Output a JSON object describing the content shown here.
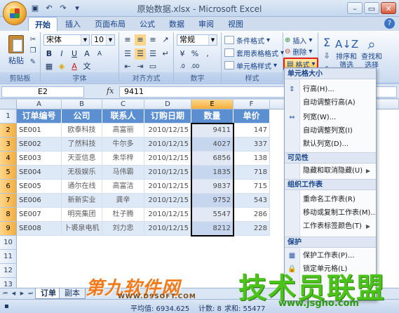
{
  "window": {
    "title": "原始数据.xlsx - Microsoft Excel"
  },
  "tabs": [
    "开始",
    "插入",
    "页面布局",
    "公式",
    "数据",
    "审阅",
    "视图"
  ],
  "ribbon": {
    "clipboard": {
      "label": "剪贴板",
      "paste": "粘贴"
    },
    "font": {
      "label": "字体",
      "name": "宋体",
      "size": "10"
    },
    "alignment": {
      "label": "对齐方式"
    },
    "number": {
      "label": "数字",
      "format": "常规"
    },
    "styles": {
      "label": "样式",
      "conditional": "条件格式",
      "table": "套用表格格式",
      "cell": "单元格样式"
    },
    "cells": {
      "insert": "插入",
      "delete": "删除",
      "format": "格式"
    },
    "editing": {
      "sigma": "Σ",
      "sort": "排序和",
      "filter": "筛选",
      "find": "查找和",
      "select": "选择"
    }
  },
  "formula_bar": {
    "name_box": "E2",
    "fx": "fx",
    "content": "9411"
  },
  "grid": {
    "columns": [
      "A",
      "B",
      "C",
      "D",
      "E",
      "F"
    ],
    "rows": [
      "1",
      "2",
      "3",
      "4",
      "5",
      "6",
      "7",
      "8",
      "9",
      "10",
      "11",
      "12",
      "13"
    ],
    "header": [
      "订单编号",
      "公司",
      "联系人",
      "订购日期",
      "数量",
      "单价"
    ],
    "data": [
      [
        "SE001",
        "欧泰科技",
        "高富丽",
        "2010/12/15",
        "9411",
        "147"
      ],
      [
        "SE002",
        "了然科技",
        "牛尔多",
        "2010/12/15",
        "4027",
        "337"
      ],
      [
        "SE003",
        "天亚信息",
        "朱华梓",
        "2010/12/15",
        "6856",
        "138"
      ],
      [
        "SE004",
        "无极娱乐",
        "马伟霸",
        "2010/12/15",
        "1835",
        "718"
      ],
      [
        "SE005",
        "通尔在线",
        "高富洁",
        "2010/12/15",
        "9837",
        "715"
      ],
      [
        "SE006",
        "新新实业",
        "龚辛",
        "2010/12/15",
        "9752",
        "543"
      ],
      [
        "SE007",
        "明亮集团",
        "杜子腾",
        "2010/12/15",
        "5547",
        "286"
      ],
      [
        "SE008",
        "卜裘泉电机",
        "刘力忠",
        "2010/12/15",
        "8212",
        "228"
      ]
    ]
  },
  "sheets": [
    "订单",
    "副本"
  ],
  "status": {
    "average": "平均值: 6934.625",
    "count": "计数: 8",
    "sum": "求和: 55477"
  },
  "format_menu": {
    "sections": [
      "单元格大小",
      "可见性",
      "组织工作表",
      "保护"
    ],
    "size_items": [
      "行高(H)...",
      "自动调整行高(A)",
      "列宽(W)...",
      "自动调整列宽(I)",
      "默认列宽(D)..."
    ],
    "visibility_items": [
      "隐藏和取消隐藏(U)"
    ],
    "organize_items": [
      "重命名工作表(R)",
      "移动或复制工作表(M)...",
      "工作表标签颜色(T)"
    ],
    "protect_items": [
      "保护工作表(P)...",
      "锁定单元格(L)"
    ]
  },
  "watermark": {
    "left": "第九软件网",
    "left_url": "WWW.D9SOFT.COM",
    "right": "技术员联盟",
    "right_url": "www.jsgho.com"
  },
  "colors": {
    "header_blue": "#5b8fd2",
    "stripe": "#dde9f7",
    "format_highlight": "#e02020"
  }
}
